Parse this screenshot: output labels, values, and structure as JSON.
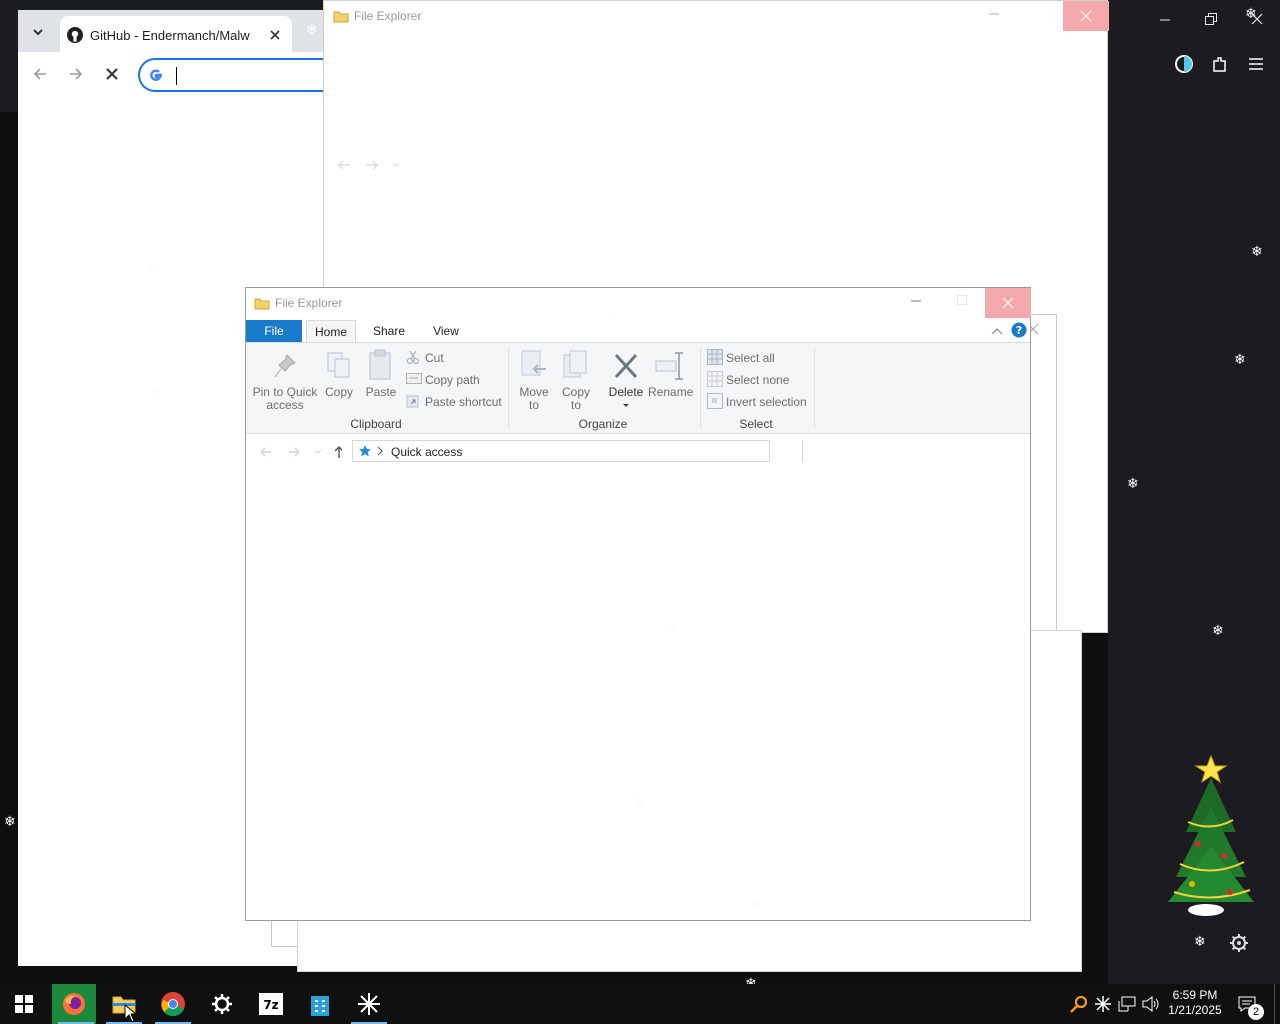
{
  "chrome": {
    "tab_title": "GitHub - Endermanch/Malware"
  },
  "explorer_back": {
    "title": "File Explorer"
  },
  "explorer": {
    "title": "File Explorer",
    "menu_tabs": [
      "File",
      "Home",
      "Share",
      "View"
    ],
    "clipboard": {
      "pin_label": "Pin to Quick access",
      "copy_label": "Copy",
      "paste_label": "Paste",
      "cut_label": "Cut",
      "copy_path_label": "Copy path",
      "paste_shortcut_label": "Paste shortcut",
      "group_label": "Clipboard"
    },
    "organize": {
      "move_to_label": "Move to",
      "copy_to_label": "Copy to",
      "delete_label": "Delete",
      "rename_label": "Rename",
      "group_label": "Organize"
    },
    "select": {
      "select_all_label": "Select all",
      "select_none_label": "Select none",
      "invert_label": "Invert selection",
      "group_label": "Select"
    },
    "address": {
      "location": "Quick access"
    }
  },
  "taskbar": {
    "time": "6:59 PM",
    "date": "1/21/2025",
    "notification_count": "2"
  },
  "colors": {
    "file_tab": "#1979ca",
    "taskbar": "#101010",
    "firefox_chrome": "#1c1b22",
    "close_hover": "#f4a8ac"
  }
}
